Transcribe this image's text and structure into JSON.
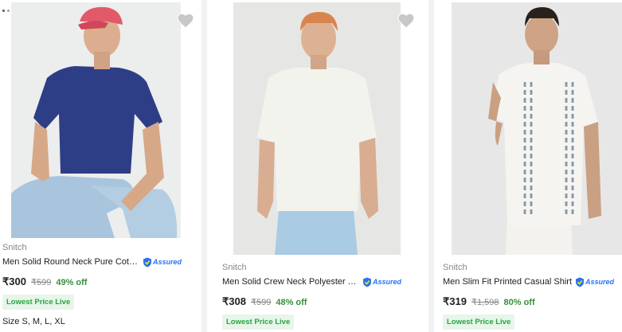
{
  "products": [
    {
      "brand": "Snitch",
      "title": "Men Solid Round Neck Pure Cotton T-Shirt",
      "assured": "Assured",
      "price": "₹300",
      "mrp": "₹599",
      "discount": "49% off",
      "badge": "Lowest Price Live",
      "sizes": "Size S, M, L, XL"
    },
    {
      "brand": "Snitch",
      "title": "Men Solid Crew Neck Polyester T-Shirt",
      "assured": "Assured",
      "price": "₹308",
      "mrp": "₹599",
      "discount": "48% off",
      "badge": "Lowest Price Live"
    },
    {
      "brand": "Snitch",
      "title": "Men Slim Fit Printed Casual Shirt",
      "assured": "Assured",
      "price": "₹319",
      "mrp": "₹1,598",
      "discount": "80% off",
      "badge": "Lowest Price Live"
    }
  ],
  "icons": {
    "wishlist": "heart-icon",
    "assured": "assured-shield-icon"
  },
  "colors": {
    "accent": "#2874f0",
    "discount": "#388e3c",
    "badge_text": "#26a541",
    "heart": "#c8c8c8"
  }
}
